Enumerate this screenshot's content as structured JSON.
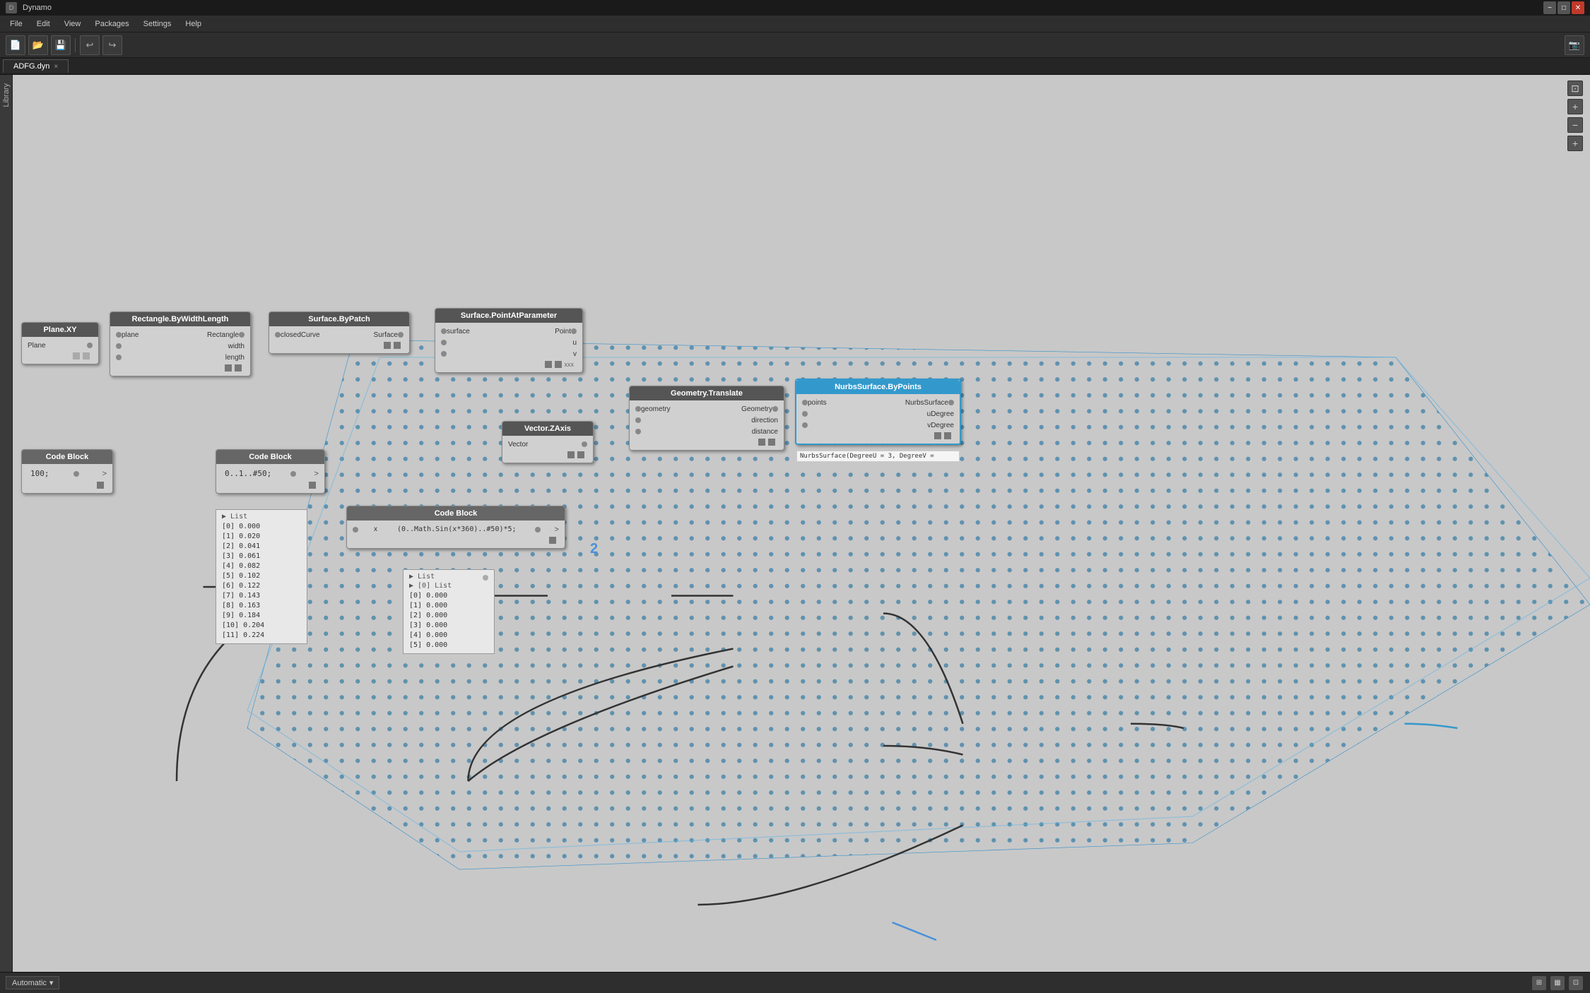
{
  "titlebar": {
    "title": "Dynamo",
    "icon": "D",
    "minimize": "−",
    "maximize": "□",
    "close": "✕"
  },
  "menubar": {
    "items": [
      "File",
      "Edit",
      "View",
      "Packages",
      "Settings",
      "Help"
    ]
  },
  "toolbar": {
    "buttons": [
      "📄",
      "📁",
      "💾",
      "↩",
      "↪"
    ]
  },
  "tab": {
    "label": "ADFG.dyn",
    "close": "×"
  },
  "library_sidebar": {
    "label": "Library"
  },
  "zoom_controls": {
    "fit": "⊡",
    "zoom_in": "+",
    "zoom_out": "−",
    "zoom_reset": "+"
  },
  "nodes": {
    "plane_xy": {
      "header": "Plane.XY",
      "ports_out": [
        "Plane"
      ]
    },
    "rectangle": {
      "header": "Rectangle.ByWidthLength",
      "ports_in": [
        "plane",
        "width",
        "length"
      ],
      "ports_out": [
        "Rectangle"
      ]
    },
    "surface_bypatch": {
      "header": "Surface.ByPatch",
      "ports_in": [
        "closedCurve"
      ],
      "ports_out": [
        "Surface"
      ]
    },
    "surface_pointatparam": {
      "header": "Surface.PointAtParameter",
      "ports_in": [
        "surface",
        "u",
        "v"
      ],
      "ports_out": [
        "Point"
      ]
    },
    "vector_zaxis": {
      "header": "Vector.ZAxis",
      "ports_out": [
        "Vector"
      ]
    },
    "geometry_translate": {
      "header": "Geometry.Translate",
      "ports_in": [
        "geometry",
        "direction",
        "distance"
      ],
      "ports_out": [
        "Geometry"
      ]
    },
    "nurbs_surface": {
      "header": "NurbsSurface.ByPoints",
      "ports_in": [
        "points",
        "uDegree",
        "vDegree"
      ],
      "ports_out": [
        "NurbsSurface"
      ]
    },
    "code_block_100": {
      "header": "Code Block",
      "code": "100;",
      "output": ">"
    },
    "code_block_range": {
      "header": "Code Block",
      "code": "0..1..#50;",
      "output": ">"
    },
    "code_block_sin": {
      "header": "Code Block",
      "input": "x",
      "code": "(0..Math.Sin(x*360)..#50)*5;",
      "output": ">"
    },
    "nurbs_tooltip": {
      "text": "NurbsSurface(DegreeU = 3, DegreeV ="
    }
  },
  "output_list_1": {
    "header": "List",
    "items": [
      "[0] 0.000",
      "[1] 0.020",
      "[2] 0.041",
      "[3] 0.061",
      "[4] 0.082",
      "[5] 0.102",
      "[6] 0.122",
      "[7] 0.143",
      "[8] 0.163",
      "[9] 0.184",
      "[10] 0.204",
      "[11] 0.224"
    ]
  },
  "output_list_2": {
    "header": "List",
    "sub_header": "[0] List",
    "items": [
      "[0] 0.000",
      "[1] 0.000",
      "[2] 0.000",
      "[3] 0.000",
      "[4] 0.000",
      "[5] 0.000"
    ]
  },
  "annotation": {
    "number": "2"
  },
  "bottom_bar": {
    "dropdown_label": "Automatic",
    "dropdown_arrow": "▾"
  }
}
